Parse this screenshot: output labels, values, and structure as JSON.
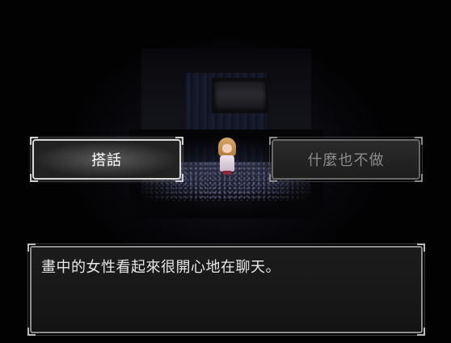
{
  "choices": {
    "talk_label": "搭話",
    "do_nothing_label": "什麼也不做"
  },
  "message": {
    "text": "畫中的女性看起來很開心地在聊天。"
  },
  "colors": {
    "selected_text": "#ffffff",
    "unselected_text": "#8c8c8c",
    "window_border": "#8e8e8e",
    "background": "#000000"
  }
}
